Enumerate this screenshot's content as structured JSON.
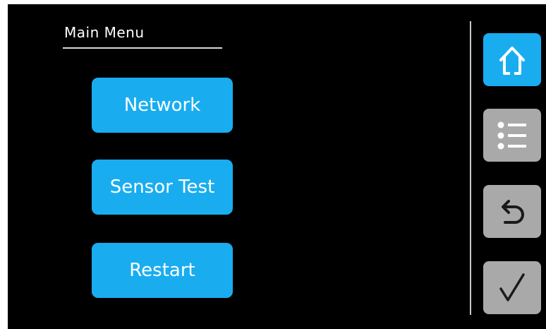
{
  "header": {
    "title": "Main Menu"
  },
  "menu": {
    "items": [
      {
        "label": "Network"
      },
      {
        "label": "Sensor Test"
      },
      {
        "label": "Restart"
      }
    ]
  },
  "sidebar": {
    "buttons": [
      {
        "icon": "home-icon",
        "state": "active"
      },
      {
        "icon": "list-icon",
        "state": "inactive"
      },
      {
        "icon": "back-arrow-icon",
        "state": "inactive"
      },
      {
        "icon": "checkmark-icon",
        "state": "inactive"
      }
    ]
  },
  "colors": {
    "background": "#000000",
    "accent": "#19adf0",
    "inactive": "#a9a9a9",
    "text": "#ffffff"
  }
}
